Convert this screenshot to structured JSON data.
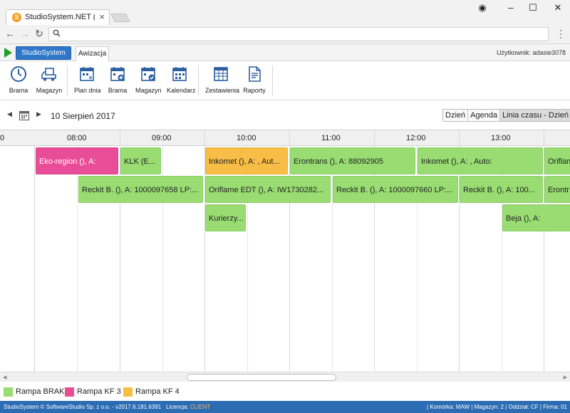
{
  "browser": {
    "tab_title": "StudioSystem.NET (c) So",
    "tab_favicon": "S",
    "tab_close": "×",
    "window_controls": {
      "user": "◉",
      "minimize": "–",
      "maximize": "☐",
      "close": "✕"
    },
    "address_value": "",
    "menu_icon": "⋮"
  },
  "app": {
    "main_button": "StudioSystem",
    "active_tab": "Awizacja",
    "user_label": "Użytkownik: adasie3078"
  },
  "ribbon": {
    "groups": [
      {
        "items": [
          {
            "label": "Brama",
            "icon": "clock-icon"
          },
          {
            "label": "Magazyn",
            "icon": "truck-icon"
          }
        ]
      },
      {
        "items": [
          {
            "label": "Plan dnia",
            "icon": "calendar-day-icon"
          },
          {
            "label": "Brama",
            "icon": "calendar-add-icon"
          },
          {
            "label": "Magazyn",
            "icon": "calendar-check-icon"
          },
          {
            "label": "Kalendarz",
            "icon": "calendar-icon"
          }
        ]
      },
      {
        "items": [
          {
            "label": "Zestawienia",
            "icon": "report-grid-icon"
          },
          {
            "label": "Raporty",
            "icon": "document-icon"
          }
        ]
      }
    ]
  },
  "calendar": {
    "date": "10 Sierpień 2017",
    "prev_arrow": "◀",
    "next_arrow": "▶",
    "views": [
      "Dzień",
      "Agenda",
      "Linia czasu - Dzień"
    ],
    "active_view": "Linia czasu - Dzień",
    "gutter_label": "0",
    "hours": [
      "08:00",
      "09:00",
      "10:00",
      "11:00",
      "12:00",
      "13:00"
    ]
  },
  "events": {
    "row1": [
      {
        "label": "Eko-region (), A:",
        "color": "pink"
      },
      {
        "label": "KLK (E...",
        "color": "green"
      },
      {
        "label": "Inkomet (), A: , Aut...",
        "color": "yellow"
      },
      {
        "label": "Erontrans (), A: 88092905",
        "color": "green"
      },
      {
        "label": "Inkomet (), A: , Auto:",
        "color": "green"
      },
      {
        "label": "Oriflam",
        "color": "green"
      }
    ],
    "row2": [
      {
        "label": "Reckit B. (), A: 1000097658 LP:...",
        "color": "green"
      },
      {
        "label": "Oriflame EDT (), A: IW1730282...",
        "color": "green"
      },
      {
        "label": "Reckit B. (), A: 1000097660 LP:...",
        "color": "green"
      },
      {
        "label": "Reckit B. (), A: 100...",
        "color": "green"
      },
      {
        "label": "Erontr",
        "color": "green"
      }
    ],
    "row3": [
      {
        "label": "Kurierzy...",
        "color": "green"
      },
      {
        "label": "Beja (), A:",
        "color": "green"
      }
    ]
  },
  "legend": [
    {
      "label": "Rampa BRAK",
      "color": "#99dd72"
    },
    {
      "label": "Rampa KF 3",
      "color": "#ea4d97"
    },
    {
      "label": "Rampa KF 4",
      "color": "#f8bd46"
    }
  ],
  "status": {
    "copyright": "StudioSystem © SoftwareStudio Sp. z o.o. - v2017.6.181.6391",
    "license_label": "Licencja:",
    "license_value": "CLIENT",
    "right_info": "| Komórka: MAW | Magazyn: 2 | Oddział: CF | Firma: 01"
  }
}
